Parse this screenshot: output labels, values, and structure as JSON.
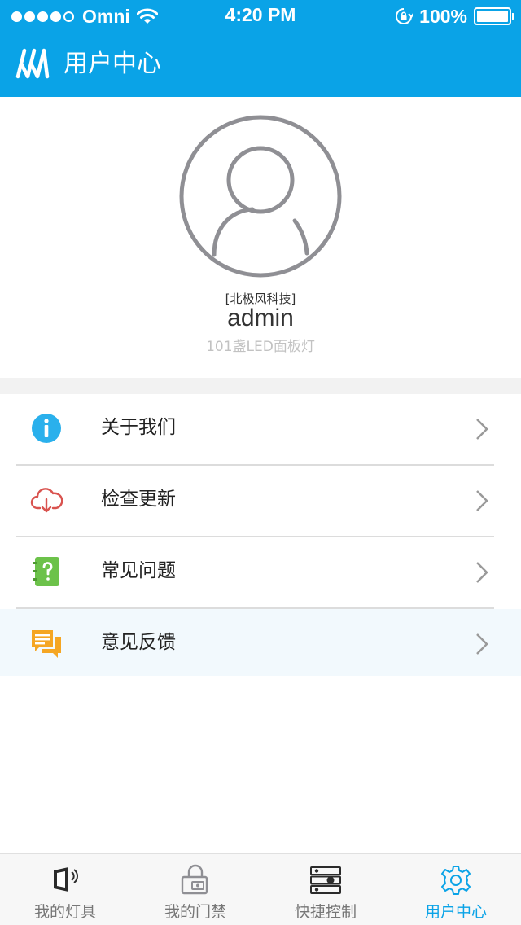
{
  "status_bar": {
    "carrier": "Omni",
    "time": "4:20 PM",
    "battery": "100%",
    "signal_bars_filled": 4,
    "signal_bars_total": 5
  },
  "nav": {
    "title": "用户中心",
    "logo_icon": "brand-logo-icon"
  },
  "profile": {
    "company": "[北极风科技]",
    "username": "admin",
    "device": "101盏LED面板灯",
    "avatar_icon": "user-avatar-icon"
  },
  "menu": {
    "items": [
      {
        "label": "关于我们",
        "icon": "info-icon"
      },
      {
        "label": "检查更新",
        "icon": "cloud-download-icon"
      },
      {
        "label": "常见问题",
        "icon": "question-notebook-icon"
      },
      {
        "label": "意见反馈",
        "icon": "feedback-chat-icon"
      }
    ]
  },
  "tabs": [
    {
      "label": "我的灯具",
      "icon": "lamp-icon"
    },
    {
      "label": "我的门禁",
      "icon": "door-lock-icon"
    },
    {
      "label": "快捷控制",
      "icon": "quick-control-icon"
    },
    {
      "label": "用户中心",
      "icon": "gear-icon",
      "active": true
    }
  ],
  "colors": {
    "brand": "#0aa3e7",
    "info_icon": "#2ab0ec",
    "update_icon": "#d9534f",
    "faq_icon": "#6cc24a",
    "feedback_icon": "#f5a623"
  }
}
